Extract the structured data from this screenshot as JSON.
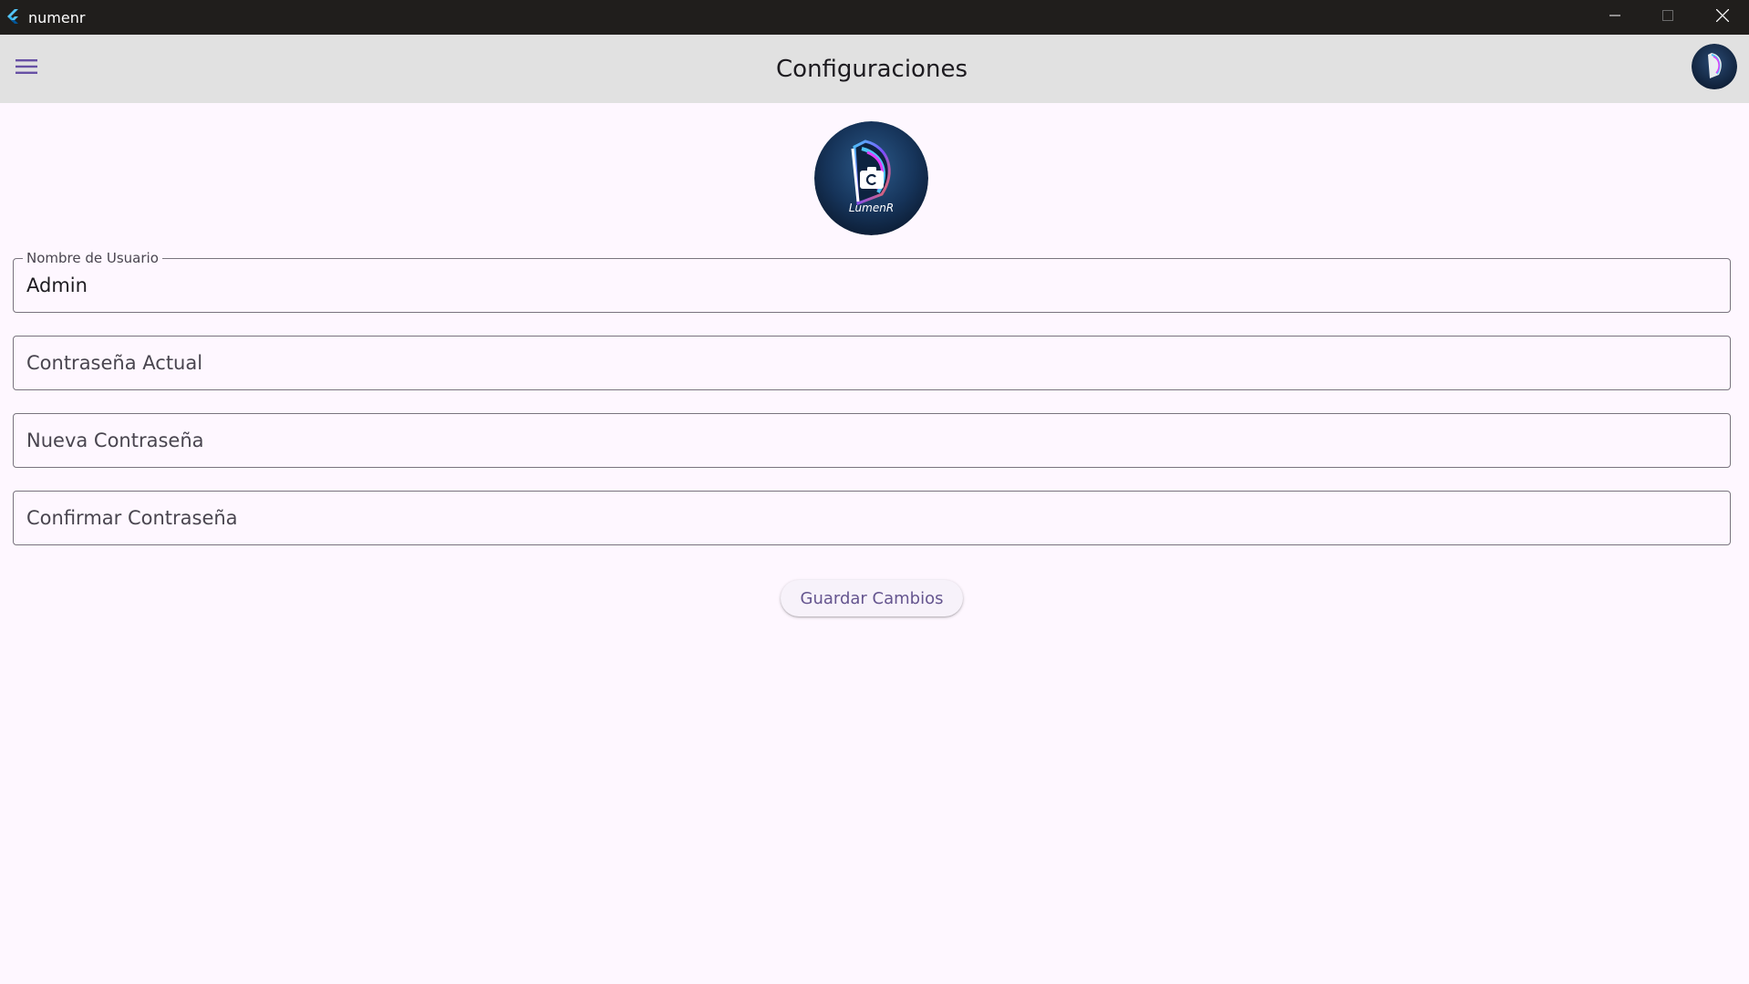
{
  "window": {
    "title": "numenr",
    "app_icon": "flutter-logo-icon",
    "controls": [
      "minimize-icon",
      "maximize-icon",
      "close-icon"
    ]
  },
  "appbar": {
    "title": "Configuraciones",
    "menu_icon": "hamburger-menu-icon",
    "avatar": "logo-avatar"
  },
  "profile": {
    "logo_text": "LumenR",
    "camera_icon": "camera-icon"
  },
  "form": {
    "username": {
      "label": "Nombre de Usuario",
      "value": "Admin"
    },
    "current_password": {
      "placeholder": "Contraseña Actual"
    },
    "new_password": {
      "placeholder": "Nueva Contraseña"
    },
    "confirm_password": {
      "placeholder": "Confirmar Contraseña"
    },
    "save_label": "Guardar Cambios"
  },
  "colors": {
    "titlebar": "#201e1c",
    "appbar": "#e1e1e1",
    "background": "#fef7ff",
    "accent": "#65558f",
    "menu_icon": "#6750a4",
    "border": "#79747e"
  }
}
